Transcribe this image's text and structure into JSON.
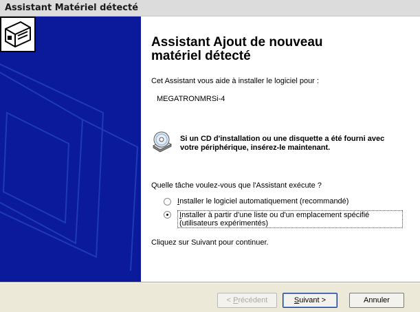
{
  "window": {
    "title": "Assistant Matériel détecté"
  },
  "main": {
    "heading": "Assistant Ajout de nouveau matériel détecté",
    "intro": "Cet Assistant vous aide à installer le logiciel pour :",
    "device": "MEGATRONMRSi-4",
    "cd_notice": "Si un CD d'installation ou une disquette a été fourni avec votre périphérique, insérez-le maintenant.",
    "question": "Quelle tâche voulez-vous que l'Assistant exécute ?",
    "options": [
      {
        "hotkey": "I",
        "rest": "nstaller le logiciel automatiquement (recommandé)",
        "selected": false
      },
      {
        "hotkey": "I",
        "rest": "nstaller à partir d'une liste ou d'un emplacement spécifié (utilisateurs expérimentés)",
        "selected": true
      }
    ],
    "continue_text": "Cliquez sur Suivant pour continuer."
  },
  "buttons": {
    "back": {
      "prefix": "< ",
      "hotkey": "P",
      "rest": "récédent",
      "enabled": false
    },
    "next": {
      "hotkey": "S",
      "rest": "uivant >"
    },
    "cancel": {
      "label": "Annuler"
    }
  },
  "colors": {
    "sidebar": "#0a1a9a",
    "titlebar": "#dcdcdc",
    "dialog": "#ece9d8"
  },
  "icons": {
    "sidebar": "hardware-device-icon",
    "cd": "cd-disk-icon"
  }
}
